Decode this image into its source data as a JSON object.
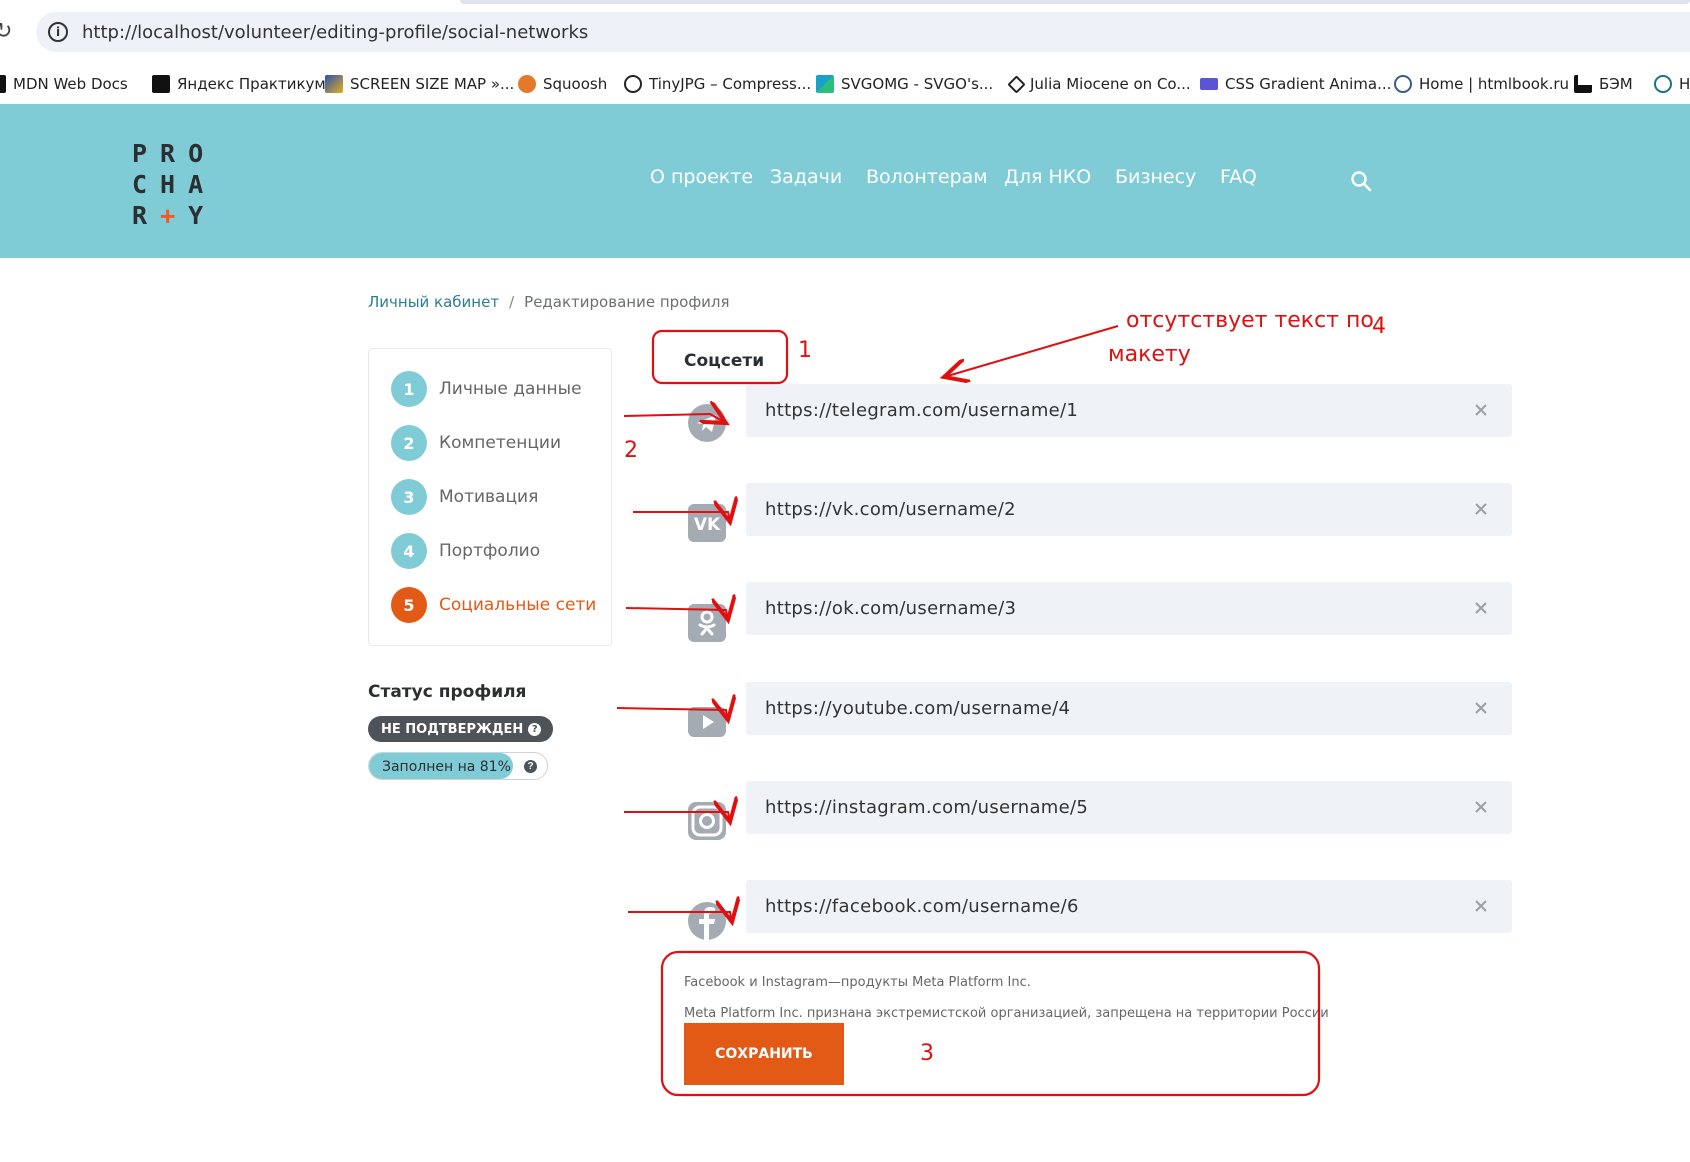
{
  "browser": {
    "url": "http://localhost/volunteer/editing-profile/social-networks",
    "bookmarks": [
      {
        "label": "MDN Web Docs",
        "icon": "mdn-icon"
      },
      {
        "label": "Яндекс Практикум",
        "icon": "yandex-practicum-icon"
      },
      {
        "label": "SCREEN SIZE MAP »...",
        "icon": "screen-size-map-icon"
      },
      {
        "label": "Squoosh",
        "icon": "squoosh-icon"
      },
      {
        "label": "TinyJPG – Compress...",
        "icon": "tinyjpg-icon"
      },
      {
        "label": "SVGOMG - SVGO's...",
        "icon": "svgomg-icon"
      },
      {
        "label": "Julia Miocene on Co...",
        "icon": "codepen-icon"
      },
      {
        "label": "CSS Gradient Anima...",
        "icon": "css-gradient-icon"
      },
      {
        "label": "Home | htmlbook.ru",
        "icon": "htmlbook-icon"
      },
      {
        "label": "БЭМ",
        "icon": "bem-icon"
      },
      {
        "label": "H",
        "icon": "react-icon"
      }
    ]
  },
  "header": {
    "logo_rows": [
      "PRO",
      "CHA",
      "R",
      "+",
      "Y"
    ],
    "nav": [
      "О проекте",
      "Задачи",
      "Волонтерам",
      "Для НКО",
      "Бизнесу",
      "FAQ"
    ]
  },
  "breadcrumb": {
    "parent": "Личный кабинет",
    "separator": "/",
    "current": "Редактирование профиля"
  },
  "steps": [
    {
      "num": "1",
      "label": "Личные данные",
      "active": false
    },
    {
      "num": "2",
      "label": "Компетенции",
      "active": false
    },
    {
      "num": "3",
      "label": "Мотивация",
      "active": false
    },
    {
      "num": "4",
      "label": "Портфолио",
      "active": false
    },
    {
      "num": "5",
      "label": "Социальные сети",
      "active": true
    }
  ],
  "status": {
    "title": "Статус профиля",
    "badge": "НЕ ПОДТВЕРЖДЕН",
    "fill_label": "Заполнен на 81%",
    "fill_percent": 81
  },
  "form": {
    "title": "Соцсети",
    "links": [
      {
        "network": "telegram-icon",
        "value": "https://telegram.com/username/1"
      },
      {
        "network": "vk-icon",
        "value": "https://vk.com/username/2"
      },
      {
        "network": "ok-icon",
        "value": "https://ok.com/username/3"
      },
      {
        "network": "youtube-icon",
        "value": "https://youtube.com/username/4"
      },
      {
        "network": "instagram-icon",
        "value": "https://instagram.com/username/5"
      },
      {
        "network": "facebook-icon",
        "value": "https://facebook.com/username/6"
      }
    ],
    "note1": "Facebook и Instagram—продукты Meta Platform Inc.",
    "note2": "Meta Platform Inc. признана экстремистской организацией, запрещена на территории России",
    "save_label": "СОХРАНИТЬ"
  },
  "annotations": {
    "n1": "1",
    "n2": "2",
    "n3": "3",
    "n4": "4",
    "comment_line1": "отсутствует текст по",
    "comment_line2": "макету",
    "color": "#e01010"
  },
  "colors": {
    "header_bg": "#80ccd6",
    "accent": "#e25a16",
    "field_bg": "#eff2f6"
  }
}
